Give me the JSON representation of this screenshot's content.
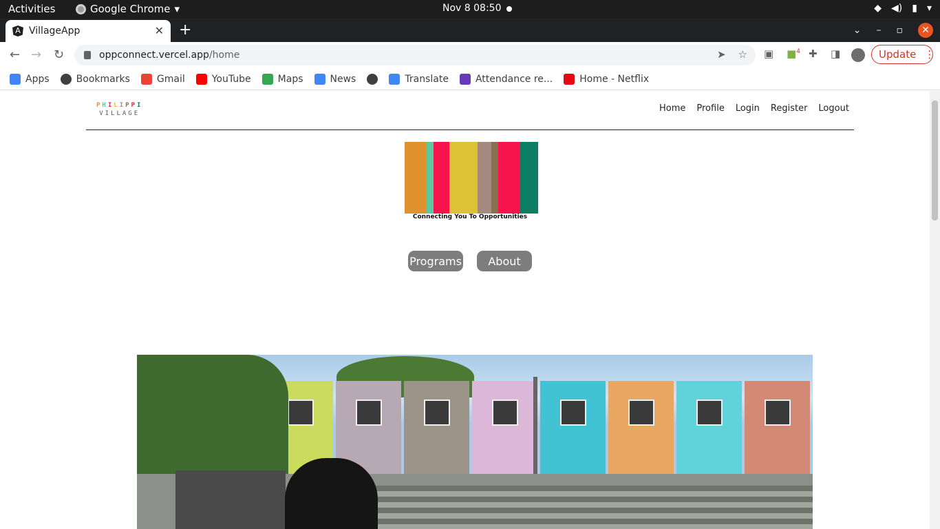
{
  "system_bar": {
    "activities": "Activities",
    "app_name": "Google Chrome",
    "clock": "Nov 8  08:50"
  },
  "browser": {
    "tab_title": "VillageApp",
    "url_host": "oppconnect.vercel.app",
    "url_path": "/home",
    "update_label": "Update",
    "extension_badge": "4"
  },
  "bookmarks": [
    {
      "label": "Apps",
      "icon": "apps-grid-icon",
      "color": "#4285f4"
    },
    {
      "label": "Bookmarks",
      "icon": "star-icon",
      "color": "#3c4043"
    },
    {
      "label": "Gmail",
      "icon": "gmail-icon",
      "color": "#ea4335"
    },
    {
      "label": "YouTube",
      "icon": "youtube-icon",
      "color": "#ff0000"
    },
    {
      "label": "Maps",
      "icon": "maps-icon",
      "color": "#34a853"
    },
    {
      "label": "News",
      "icon": "news-icon",
      "color": "#4285f4"
    },
    {
      "label": "",
      "icon": "globe-icon",
      "color": "#3c4043"
    },
    {
      "label": "Translate",
      "icon": "translate-icon",
      "color": "#4285f4"
    },
    {
      "label": "Attendance re...",
      "icon": "forms-icon",
      "color": "#673ab7"
    },
    {
      "label": "Home - Netflix",
      "icon": "netflix-icon",
      "color": "#e50914"
    }
  ],
  "site": {
    "logo_line1": "PHILIPPI",
    "logo_line2": "VILLAGE",
    "nav": [
      "Home",
      "Profile",
      "Login",
      "Register",
      "Logout"
    ],
    "tagline": "Connecting You To Opportunities",
    "banner_colors": [
      "#e0922e",
      "#5ec9a0",
      "#f7134c",
      "#dcc234",
      "#a68a82",
      "#857050",
      "#f7134c",
      "#0b7f66"
    ],
    "buttons": {
      "programs": "Programs",
      "about": "About"
    },
    "button_color": "#7d7d7d",
    "hero_container_colors": [
      "#cbdb5e",
      "#b7a9b4",
      "#9c9488",
      "#dbb7d8",
      "#42c3d4",
      "#e8a763",
      "#5fd3d9",
      "#d28a76"
    ]
  }
}
